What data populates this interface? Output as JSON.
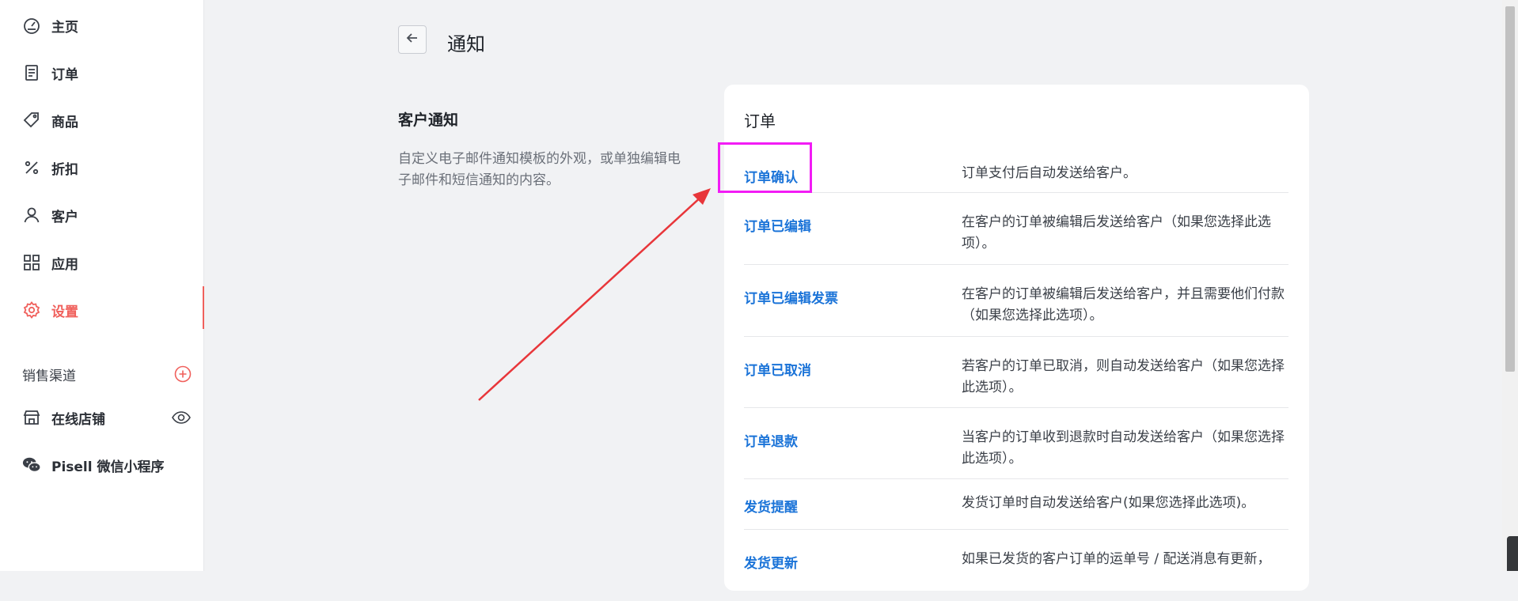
{
  "sidebar": {
    "items": [
      {
        "label": "主页",
        "icon": "dashboard-icon"
      },
      {
        "label": "订单",
        "icon": "order-icon"
      },
      {
        "label": "商品",
        "icon": "tag-icon"
      },
      {
        "label": "折扣",
        "icon": "percent-icon"
      },
      {
        "label": "客户",
        "icon": "user-icon"
      },
      {
        "label": "应用",
        "icon": "apps-icon"
      },
      {
        "label": "设置",
        "icon": "gear-icon",
        "active": true
      }
    ],
    "sales_channels": {
      "title": "销售渠道",
      "items": [
        {
          "label": "在线店铺",
          "icon": "store-icon"
        },
        {
          "label": "Pisell 微信小程序",
          "icon": "wechat-icon"
        }
      ]
    }
  },
  "header": {
    "title": "通知"
  },
  "customer_notifications": {
    "title": "客户通知",
    "description": "自定义电子邮件通知模板的外观，或单独编辑电子邮件和短信通知的内容。"
  },
  "orders_card": {
    "title": "订单",
    "rows": [
      {
        "name": "订单确认",
        "desc": "订单支付后自动发送给客户。"
      },
      {
        "name": "订单已编辑",
        "desc": "在客户的订单被编辑后发送给客户（如果您选择此选项）。"
      },
      {
        "name": "订单已编辑发票",
        "desc": "在客户的订单被编辑后发送给客户，并且需要他们付款（如果您选择此选项）。"
      },
      {
        "name": "订单已取消",
        "desc": "若客户的订单已取消，则自动发送给客户（如果您选择此选项）。"
      },
      {
        "name": "订单退款",
        "desc": "当客户的订单收到退款时自动发送给客户（如果您选择此选项）。"
      },
      {
        "name": "发货提醒",
        "desc": "发货订单时自动发送给客户(如果您选择此选项)。"
      },
      {
        "name": "发货更新",
        "desc": "如果已发货的客户订单的运单号 / 配送消息有更新，"
      }
    ]
  },
  "colors": {
    "accent": "#f0605c",
    "link": "#1a73d8",
    "highlight": "#f21cf5",
    "arrow": "#e8363a"
  }
}
